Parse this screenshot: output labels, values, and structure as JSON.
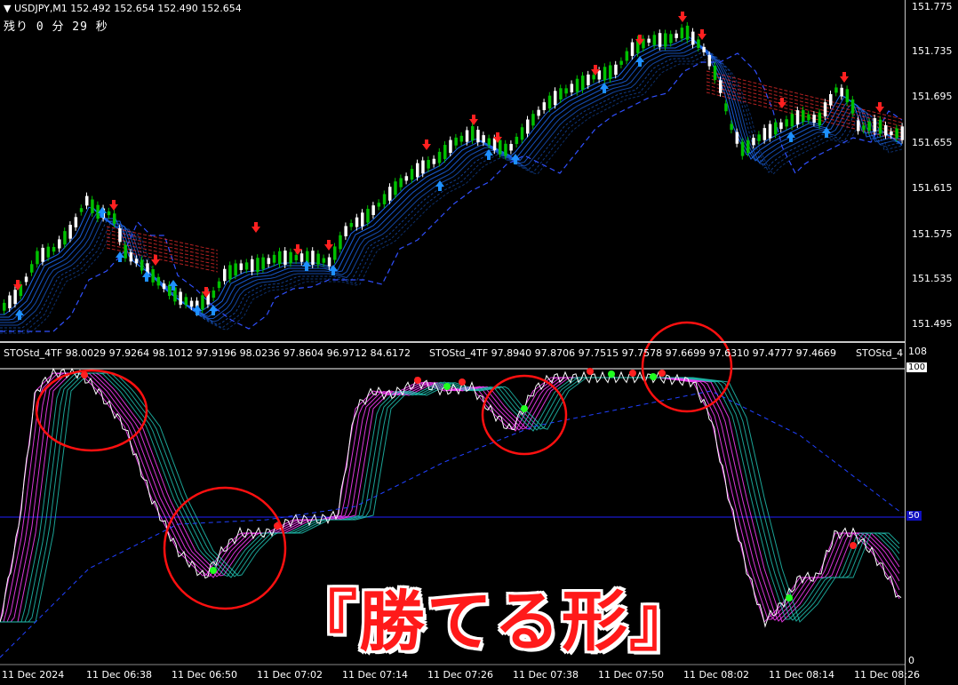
{
  "header": {
    "symbol_text": "▼ USDJPY,M1  152.492 152.654 152.490 152.654",
    "countdown": "残り 0 分 29 秒"
  },
  "price_axis": {
    "labels": [
      "151.775",
      "151.735",
      "151.695",
      "151.655",
      "151.615",
      "151.575",
      "151.535",
      "151.495"
    ]
  },
  "indicator": {
    "header1": "STOStd_4TF 98.0029 97.9264 98.1012 97.9196 98.0236 97.8604 96.9712 84.6172",
    "header2": "STOStd_4TF 97.8940 97.8706 97.7515 97.7578 97.6699 97.6310 97.4777 97.4669",
    "header3": "STOStd_4",
    "axis_108": "108",
    "axis_100": "100",
    "axis_50": "50",
    "axis_0": "0"
  },
  "time_axis": {
    "labels": [
      "11 Dec 2024",
      "11 Dec 06:38",
      "11 Dec 06:50",
      "11 Dec 07:02",
      "11 Dec 07:14",
      "11 Dec 07:26",
      "11 Dec 07:38",
      "11 Dec 07:50",
      "11 Dec 08:02",
      "11 Dec 08:14",
      "11 Dec 08:26"
    ]
  },
  "caption": "『勝てる形』",
  "colors": {
    "bull": "#00c000",
    "bear": "#ffffff",
    "up_arrow": "#1e90ff",
    "down_arrow": "#ff2020",
    "ma_fast": "#1e6fff",
    "ma_slow_red": "#ff3030",
    "stoch_magenta": "#ff40ff",
    "stoch_teal": "#20c0b0",
    "highlight_circle": "#ff1010",
    "level_line": "#2020ff"
  }
}
